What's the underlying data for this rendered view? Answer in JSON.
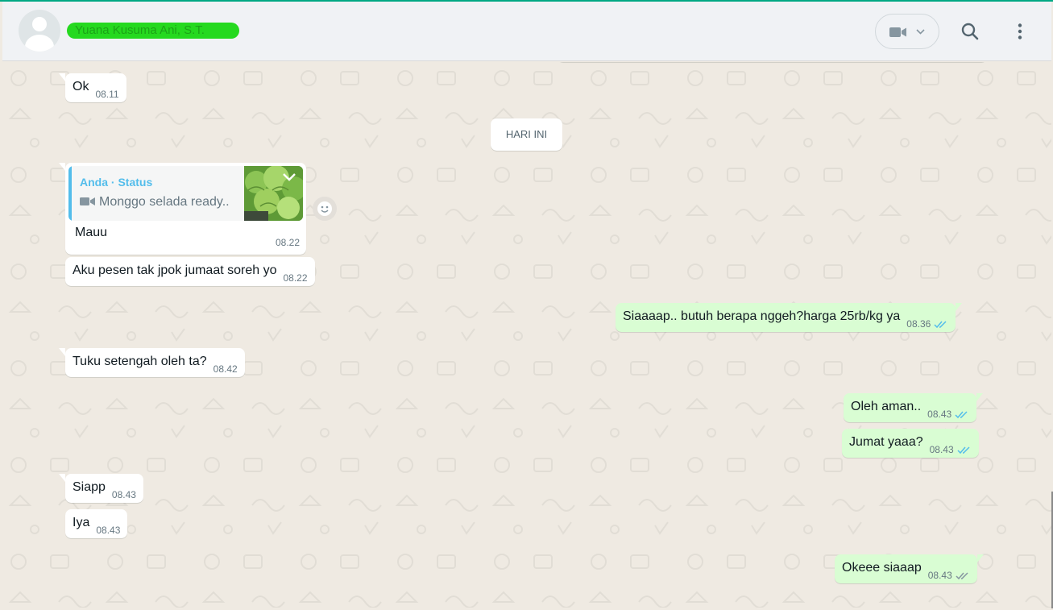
{
  "header": {
    "contact_name": "Yuana Kusuma Ani, S.T.",
    "video_call_label": "video-camera",
    "icons": [
      "video-camera-icon",
      "chevron-down-icon",
      "search-icon",
      "menu-icon"
    ]
  },
  "colors": {
    "accent": "#00a884",
    "incoming_bubble": "#ffffff",
    "outgoing_bubble": "#d9fdd3",
    "chat_background": "#efeae2",
    "read_tick": "#53bdeb",
    "name_redaction": "#25d91f"
  },
  "chat": {
    "day_separator": "HARI INI",
    "messages": [
      {
        "dir": "in",
        "text": "Ok",
        "time": "08.11"
      },
      {
        "dir": "in",
        "quote_author": "Anda · Status",
        "quote_text": "Monggo selada ready..",
        "quote_icon": "video-camera-icon",
        "text": "Mauu",
        "time": "08.22"
      },
      {
        "dir": "in",
        "text": "Aku pesen tak jpok jumaat soreh yo",
        "time": "08.22"
      },
      {
        "dir": "out",
        "text": "Siaaaap.. butuh berapa nggeh?harga 25rb/kg ya",
        "time": "08.36",
        "status": "read"
      },
      {
        "dir": "in",
        "text": "Tuku setengah oleh ta?",
        "time": "08.42"
      },
      {
        "dir": "out",
        "text": "Oleh aman..",
        "time": "08.43",
        "status": "read"
      },
      {
        "dir": "out",
        "text": "Jumat yaaa?",
        "time": "08.43",
        "status": "read"
      },
      {
        "dir": "in",
        "text": "Siapp",
        "time": "08.43"
      },
      {
        "dir": "in",
        "text": "Iya",
        "time": "08.43"
      },
      {
        "dir": "out",
        "text": "Okeee siaaap",
        "time": "08.43",
        "status": "delivered"
      }
    ]
  }
}
